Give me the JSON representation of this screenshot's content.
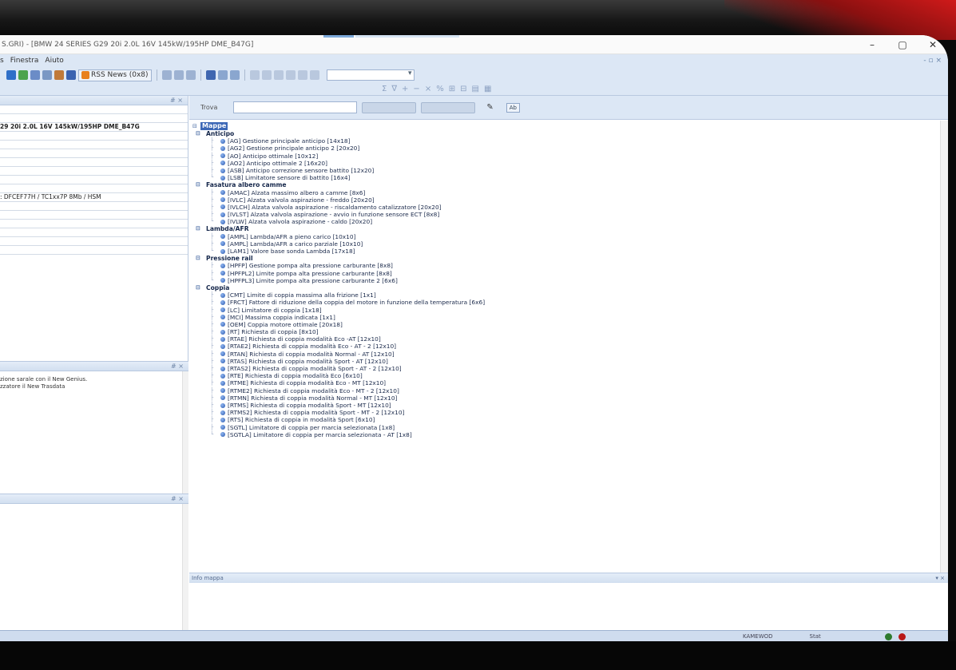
{
  "window": {
    "title": "S.GRI) - [BMW 24 SERIES G29 20i 2.0L 16V 145kW/195HP DME_B47G]",
    "controls": [
      "–",
      "▢",
      "✕"
    ]
  },
  "menu": {
    "items": [
      "s",
      "Finestra",
      "Aiuto"
    ],
    "right_marker": "- ▫ ×"
  },
  "toolbar": {
    "rss_label": "RSS News (0x8)",
    "combo_value": ""
  },
  "left_panel": {
    "header_pin": "# ×",
    "rows": [
      "",
      "",
      "29 20i 2.0L 16V 145kW/195HP DME_B47G",
      "",
      "",
      "",
      "",
      "",
      "",
      "",
      ": DFCEF77H / TC1xx7P 8Mb / HSM",
      "",
      "",
      "",
      "",
      "",
      ""
    ],
    "messages_pin": "# ×",
    "messages": [
      "zione sarale con il New Genius.",
      "zzatore il New Trasdata"
    ],
    "bottom_pin": "# ×"
  },
  "search": {
    "label": "Trova",
    "placeholder": "",
    "btn1": "",
    "btn2": "",
    "ab_label": "Ab"
  },
  "tree": {
    "root": "Mappe",
    "categories": [
      {
        "name": "Anticipo",
        "items": [
          "[AG] Gestione principale anticipo [14x18]",
          "[AG2] Gestione principale anticipo 2 [20x20]",
          "[AO] Anticipo ottimale [10x12]",
          "[AO2] Anticipo ottimale 2 [16x20]",
          "[ASB] Anticipo correzione sensore battito [12x20]",
          "[LSB] Limitatore sensore di battito [16x4]"
        ]
      },
      {
        "name": "Fasatura albero camme",
        "items": [
          "[AMAC] Alzata massimo albero a camme [8x6]",
          "[IVLC] Alzata valvola aspirazione - freddo [20x20]",
          "[IVLCH] Alzata valvola aspirazione - riscaldamento catalizzatore [20x20]",
          "[IVLST] Alzata valvola aspirazione - avvio in funzione sensore ECT [8x8]",
          "[IVLW] Alzata valvola aspirazione - caldo [20x20]"
        ]
      },
      {
        "name": "Lambda/AFR",
        "items": [
          "[AMPL] Lambda/AFR a pieno carico [10x10]",
          "[AMPL] Lambda/AFR a carico parziale [10x10]",
          "[LAM1] Valore base sonda Lambda [17x18]"
        ]
      },
      {
        "name": "Pressione rail",
        "items": [
          "[HPFP] Gestione pompa alta pressione carburante [8x8]",
          "[HPFPL2] Limite pompa alta pressione carburante [8x8]",
          "[HPFPL3] Limite pompa alta pressione carburante 2 [6x6]"
        ]
      },
      {
        "name": "Coppia",
        "items": [
          "[CMT] Limite di coppia massima alla frizione [1x1]",
          "[FRCT] Fattore di riduzione della coppia del motore in funzione della temperatura [6x6]",
          "[LC] Limitatore di coppia [1x18]",
          "[MCI] Massima coppia indicata [1x1]",
          "[OEM] Coppia motore ottimale [20x18]",
          "[RT] Richiesta di coppia [8x10]",
          "[RTAE] Richiesta di coppia modalità Eco -AT [12x10]",
          "[RTAE2] Richiesta di coppia modalità Eco - AT - 2 [12x10]",
          "[RTAN] Richiesta di coppia modalità Normal - AT [12x10]",
          "[RTAS] Richiesta di coppia modalità Sport - AT [12x10]",
          "[RTAS2] Richiesta di coppia modalità Sport - AT - 2 [12x10]",
          "[RTE] Richiesta di coppia modalità Eco [6x10]",
          "[RTME] Richiesta di coppia modalità Eco - MT [12x10]",
          "[RTME2] Richiesta di coppia modalità Eco - MT - 2 [12x10]",
          "[RTMN] Richiesta di coppia modalità Normal - MT [12x10]",
          "[RTMS] Richiesta di coppia modalità Sport - MT [12x10]",
          "[RTMS2] Richiesta di coppia modalità Sport - MT - 2 [12x10]",
          "[RTS] Richiesta di coppia in modalità Sport [6x10]",
          "[SGTL] Limitatore di coppia per marcia selezionata [1x8]",
          "[SGTLA] Limitatore di coppia per marcia selezionata - AT [1x8]"
        ]
      }
    ]
  },
  "info_panel": {
    "title": "Info mappa",
    "pin": "▾ ×"
  },
  "status": {
    "left_text": "KAMEWOD",
    "right_text": "Stat"
  },
  "colors": {
    "accent": "#3d68b6",
    "led_green": "#2e7a2e",
    "led_red": "#b81818"
  }
}
